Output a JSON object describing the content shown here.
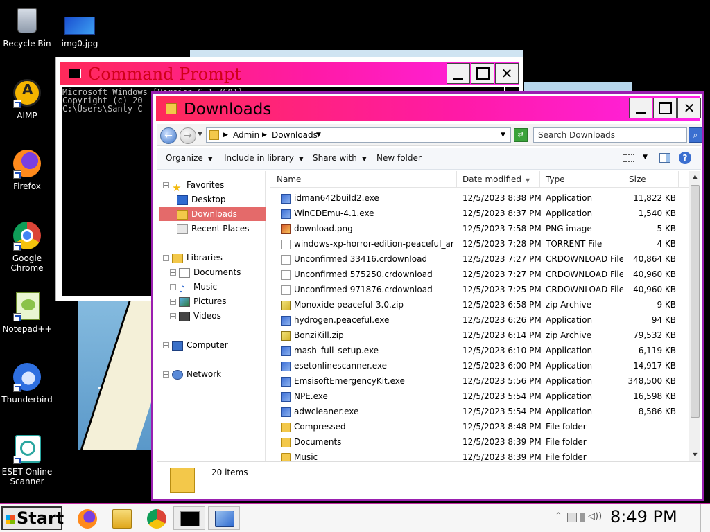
{
  "desktop": {
    "icons": [
      {
        "label": "Recycle Bin"
      },
      {
        "label": "img0.jpg"
      },
      {
        "label": "AIMP"
      },
      {
        "label": "Firefox"
      },
      {
        "label": "Google Chrome"
      },
      {
        "label": "Notepad++"
      },
      {
        "label": "Thunderbird"
      },
      {
        "label": "ESET Online Scanner"
      }
    ]
  },
  "cmd": {
    "title": "Command Prompt",
    "lines": [
      "Microsoft Windows [Version 6.1.7601]",
      "Copyright (c) 20",
      "",
      "C:\\Users\\Santy C"
    ]
  },
  "explorer": {
    "title": "Downloads",
    "breadcrumb": [
      "Admin",
      "Downloads"
    ],
    "search_placeholder": "Search Downloads",
    "toolbar": {
      "organize": "Organize",
      "include": "Include in library",
      "share": "Share with",
      "newfolder": "New folder"
    },
    "nav": {
      "favorites": "Favorites",
      "desktop": "Desktop",
      "downloads": "Downloads",
      "recent": "Recent Places",
      "libraries": "Libraries",
      "documents": "Documents",
      "music": "Music",
      "pictures": "Pictures",
      "videos": "Videos",
      "computer": "Computer",
      "network": "Network"
    },
    "columns": {
      "name": "Name",
      "date": "Date modified",
      "type": "Type",
      "size": "Size"
    },
    "files": [
      {
        "name": "idman642build2.exe",
        "date": "12/5/2023 8:38 PM",
        "type": "Application",
        "size": "11,822 KB",
        "icon": "app"
      },
      {
        "name": "WinCDEmu-4.1.exe",
        "date": "12/5/2023 8:37 PM",
        "type": "Application",
        "size": "1,540 KB",
        "icon": "app"
      },
      {
        "name": "download.png",
        "date": "12/5/2023 7:58 PM",
        "type": "PNG image",
        "size": "5 KB",
        "icon": "png"
      },
      {
        "name": "windows-xp-horror-edition-peaceful_arc...",
        "date": "12/5/2023 7:28 PM",
        "type": "TORRENT File",
        "size": "4 KB",
        "icon": "doc"
      },
      {
        "name": "Unconfirmed 33416.crdownload",
        "date": "12/5/2023 7:27 PM",
        "type": "CRDOWNLOAD File",
        "size": "40,864 KB",
        "icon": "doc"
      },
      {
        "name": "Unconfirmed 575250.crdownload",
        "date": "12/5/2023 7:27 PM",
        "type": "CRDOWNLOAD File",
        "size": "40,960 KB",
        "icon": "doc"
      },
      {
        "name": "Unconfirmed 971876.crdownload",
        "date": "12/5/2023 7:25 PM",
        "type": "CRDOWNLOAD File",
        "size": "40,960 KB",
        "icon": "doc"
      },
      {
        "name": "Monoxide-peaceful-3.0.zip",
        "date": "12/5/2023 6:58 PM",
        "type": "zip Archive",
        "size": "9 KB",
        "icon": "zip"
      },
      {
        "name": "hydrogen.peaceful.exe",
        "date": "12/5/2023 6:26 PM",
        "type": "Application",
        "size": "94 KB",
        "icon": "app"
      },
      {
        "name": "BonziKill.zip",
        "date": "12/5/2023 6:14 PM",
        "type": "zip Archive",
        "size": "79,532 KB",
        "icon": "zip"
      },
      {
        "name": "mash_full_setup.exe",
        "date": "12/5/2023 6:10 PM",
        "type": "Application",
        "size": "6,119 KB",
        "icon": "app"
      },
      {
        "name": "esetonlinescanner.exe",
        "date": "12/5/2023 6:00 PM",
        "type": "Application",
        "size": "14,917 KB",
        "icon": "app"
      },
      {
        "name": "EmsisoftEmergencyKit.exe",
        "date": "12/5/2023 5:56 PM",
        "type": "Application",
        "size": "348,500 KB",
        "icon": "app"
      },
      {
        "name": "NPE.exe",
        "date": "12/5/2023 5:54 PM",
        "type": "Application",
        "size": "16,598 KB",
        "icon": "app"
      },
      {
        "name": "adwcleaner.exe",
        "date": "12/5/2023 5:54 PM",
        "type": "Application",
        "size": "8,586 KB",
        "icon": "app"
      },
      {
        "name": "Compressed",
        "date": "12/5/2023 8:48 PM",
        "type": "File folder",
        "size": "",
        "icon": "folder"
      },
      {
        "name": "Documents",
        "date": "12/5/2023 8:39 PM",
        "type": "File folder",
        "size": "",
        "icon": "folder"
      },
      {
        "name": "Music",
        "date": "12/5/2023 8:39 PM",
        "type": "File folder",
        "size": "",
        "icon": "folder"
      }
    ],
    "status": "20 items"
  },
  "taskbar": {
    "start": "Start",
    "clock": "8:49 PM"
  }
}
